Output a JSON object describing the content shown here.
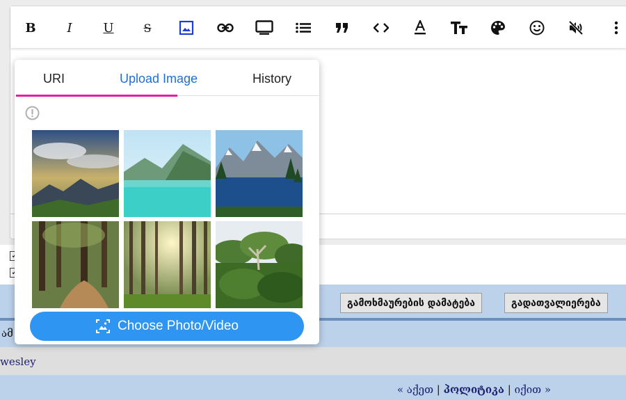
{
  "toolbar": {
    "bold_label": "B",
    "italic_label": "I",
    "underline_label": "U",
    "strike_label": "S",
    "icons": [
      "bold-icon",
      "italic-icon",
      "underline-icon",
      "strikethrough-icon",
      "image-icon",
      "link-icon",
      "video-icon",
      "list-icon",
      "quote-icon",
      "code-icon",
      "text-color-icon",
      "font-size-icon",
      "palette-icon",
      "emoji-icon",
      "mute-icon",
      "more-icon"
    ],
    "accent_color": "#1b6fd6"
  },
  "image_popup": {
    "tabs": [
      {
        "label": "URI",
        "active": false
      },
      {
        "label": "Upload Image",
        "active": true
      },
      {
        "label": "History",
        "active": false
      }
    ],
    "tab_accent": "#e51ca6",
    "thumbnails": [
      "sunset-mountains",
      "turquoise-lake",
      "alpine-lake",
      "forest-path",
      "sunlit-forest",
      "rainforest-canopy"
    ],
    "choose_button": "Choose Photo/Video",
    "button_color": "#2f95f3"
  },
  "form": {
    "checkboxes": [
      {
        "checked": true
      },
      {
        "checked": true
      }
    ],
    "buttons": {
      "add_comment": "გამოხმაურების დამატება",
      "preview": "გადათვალიერება"
    }
  },
  "bands": {
    "partial_label": "ამ",
    "author": "wesley"
  },
  "nav": {
    "prev": "« აქეთ",
    "category": "პოლიტიკა",
    "next": "იქით »"
  }
}
